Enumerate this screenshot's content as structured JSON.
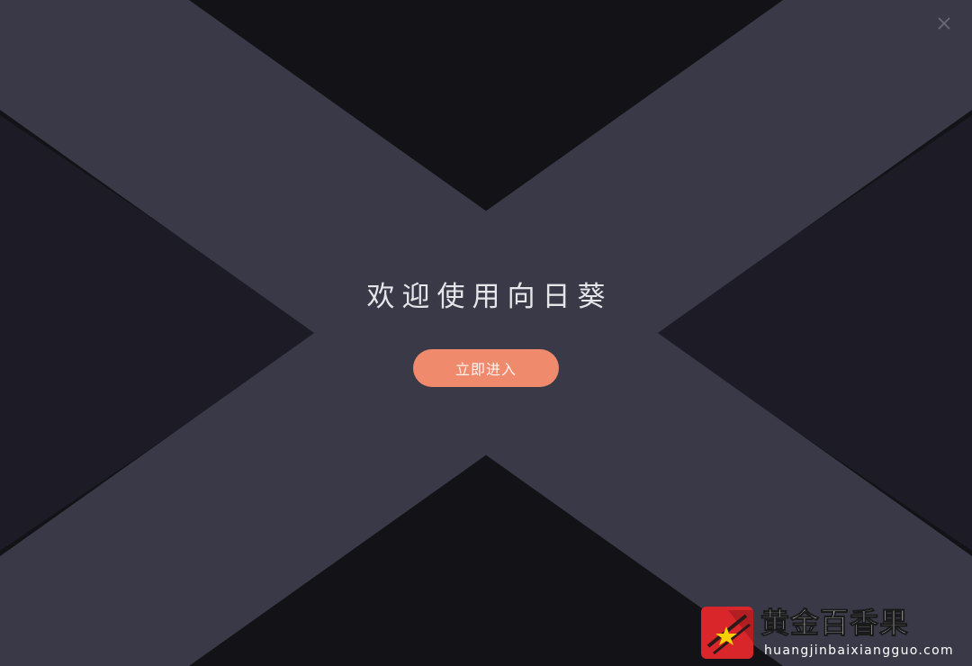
{
  "welcome": {
    "title": "欢迎使用向日葵",
    "enter_button": "立即进入"
  },
  "window": {
    "close_glyph": "×"
  },
  "watermark": {
    "title": "黄金百香果",
    "url": "huangjinbaixiangguo.com"
  },
  "colors": {
    "band": "#3a3947",
    "background_dark": "#131317",
    "button_accent": "#ef8a6d",
    "logo_red": "#d9262b"
  }
}
